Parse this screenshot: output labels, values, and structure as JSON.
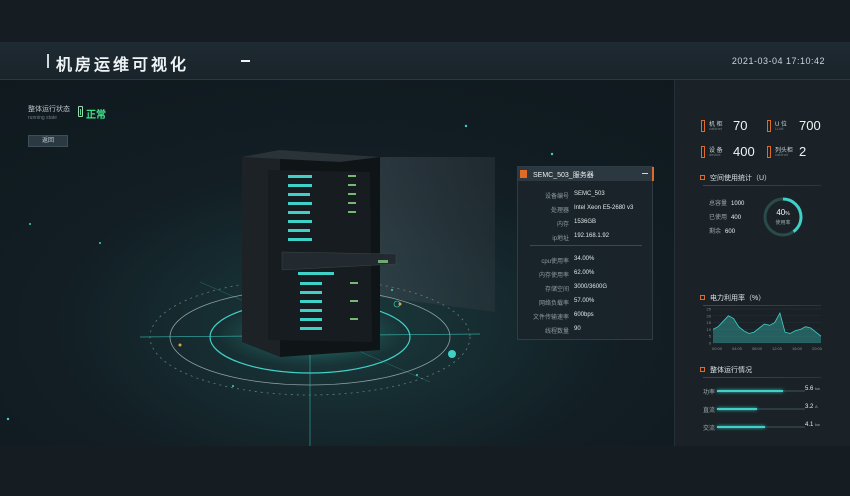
{
  "header": {
    "title": "机房运维可视化",
    "datetime": "2021-03-04 17:10:42"
  },
  "status": {
    "label": "整体运行状态",
    "sublabel": "running state",
    "value": "正常",
    "back_label": "返回"
  },
  "server_panel": {
    "title": "SEMC_503_服务器",
    "info": [
      {
        "key": "设备编号",
        "value": "SEMC_503"
      },
      {
        "key": "处理器",
        "value": "Intel Xeon E5-2680 v3"
      },
      {
        "key": "内存",
        "value": "1536GB"
      },
      {
        "key": "ip地址",
        "value": "192.168.1.92"
      }
    ],
    "metrics": [
      {
        "key": "cpu使用率",
        "value": "34.00%"
      },
      {
        "key": "内存使用率",
        "value": "62.00%"
      },
      {
        "key": "存储空间",
        "value": "3000/3600G"
      },
      {
        "key": "网络负载率",
        "value": "57.00%"
      },
      {
        "key": "文件传输速率",
        "value": "600bps"
      },
      {
        "key": "线程数量",
        "value": "90"
      }
    ]
  },
  "stats": [
    {
      "label": "机 柜",
      "sub": "cabinet",
      "value": "70"
    },
    {
      "label": "U 位",
      "sub": "U-bit",
      "value": "700"
    },
    {
      "label": "设 备",
      "sub": "device",
      "value": "400"
    },
    {
      "label": "列头柜",
      "sub": "cabinet",
      "value": "2"
    }
  ],
  "space": {
    "title": "空间使用统计（U）",
    "rows": [
      {
        "key": "总容量",
        "value": "1000"
      },
      {
        "key": "已使用",
        "value": "400"
      },
      {
        "key": "剩余",
        "value": "600"
      }
    ],
    "percent": 40,
    "percent_text": "40",
    "percent_unit": "%",
    "caption": "使用率"
  },
  "power_chart": {
    "title": "电力利用率（%）",
    "chart_data": {
      "type": "area",
      "x": [
        "00:00",
        "04:00",
        "08:00",
        "12:00",
        "16:00",
        "20:00"
      ],
      "yticks": [
        "25",
        "20",
        "15",
        "10",
        "5",
        "0"
      ],
      "ylim": [
        0,
        25
      ],
      "values": [
        10,
        12,
        16,
        20,
        18,
        12,
        9,
        7,
        8,
        11,
        14,
        13,
        15,
        22,
        8,
        7,
        9,
        10,
        12,
        11,
        8,
        5
      ],
      "color": "#3fd0c8"
    }
  },
  "overall": {
    "title": "整体运行情况",
    "rows": [
      {
        "key": "功率",
        "value": "5.6",
        "unit": "kw",
        "ratio": 0.75
      },
      {
        "key": "直流",
        "value": "3.2",
        "unit": "A",
        "ratio": 0.45
      },
      {
        "key": "交流",
        "value": "4.1",
        "unit": "kw",
        "ratio": 0.55
      }
    ]
  },
  "colors": {
    "accent": "#3fd0c8",
    "orange": "#e06a28",
    "ok": "#3fe08a"
  }
}
